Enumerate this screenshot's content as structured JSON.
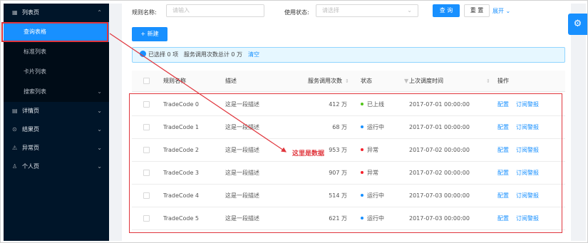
{
  "sidebar": {
    "list_group": {
      "label": "列表页",
      "icon": "table-icon"
    },
    "list_items": [
      {
        "label": "查询表格",
        "active": true
      },
      {
        "label": "标准列表"
      },
      {
        "label": "卡片列表"
      },
      {
        "label": "搜索列表"
      }
    ],
    "groups": [
      {
        "label": "详情页",
        "icon": "profile-icon"
      },
      {
        "label": "结果页",
        "icon": "check-circle-icon"
      },
      {
        "label": "异常页",
        "icon": "warning-icon"
      },
      {
        "label": "个人页",
        "icon": "user-icon"
      }
    ]
  },
  "filters": {
    "rule_name_label": "规则名称:",
    "rule_name_placeholder": "请输入",
    "status_label": "使用状态:",
    "status_placeholder": "请选择",
    "query_button": "查 询",
    "reset_button": "重 置",
    "expand_link": "展开"
  },
  "toolbar": {
    "new_button": "+ 新建"
  },
  "alert": {
    "selected_text": "已选择 0 项",
    "total_text": "服务调用次数总计 0 万",
    "clear_link": "清空"
  },
  "table": {
    "columns": {
      "name": "规则名称",
      "desc": "描述",
      "calls": "服务调用次数",
      "status": "状态",
      "time": "上次调度时间",
      "ops": "操作"
    },
    "rows": [
      {
        "name": "TradeCode 0",
        "desc": "这是一段描述",
        "calls": "412 万",
        "status": "已上线",
        "status_color": "#52c41a",
        "time": "2017-07-01 00:00:00",
        "op1": "配置",
        "op2": "订阅警报"
      },
      {
        "name": "TradeCode 1",
        "desc": "这是一段描述",
        "calls": "68 万",
        "status": "运行中",
        "status_color": "#1890ff",
        "time": "2017-07-01 00:00:00",
        "op1": "配置",
        "op2": "订阅警报"
      },
      {
        "name": "TradeCode 2",
        "desc": "这是一段描述",
        "calls": "953 万",
        "status": "异常",
        "status_color": "#f5222d",
        "time": "2017-07-02 00:00:00",
        "op1": "配置",
        "op2": "订阅警报"
      },
      {
        "name": "TradeCode 3",
        "desc": "这是一段描述",
        "calls": "907 万",
        "status": "异常",
        "status_color": "#f5222d",
        "time": "2017-07-02 00:00:00",
        "op1": "配置",
        "op2": "订阅警报"
      },
      {
        "name": "TradeCode 4",
        "desc": "这是一段描述",
        "calls": "514 万",
        "status": "运行中",
        "status_color": "#1890ff",
        "time": "2017-07-03 00:00:00",
        "op1": "配置",
        "op2": "订阅警报"
      },
      {
        "name": "TradeCode 5",
        "desc": "这是一段描述",
        "calls": "621 万",
        "status": "运行中",
        "status_color": "#1890ff",
        "time": "2017-07-03 00:00:00",
        "op1": "配置",
        "op2": "订阅警报"
      }
    ]
  },
  "annotation": {
    "text": "这里是数据"
  },
  "colors": {
    "primary": "#1890ff",
    "annotation": "#e0353c",
    "sidebar_bg": "#001529"
  }
}
